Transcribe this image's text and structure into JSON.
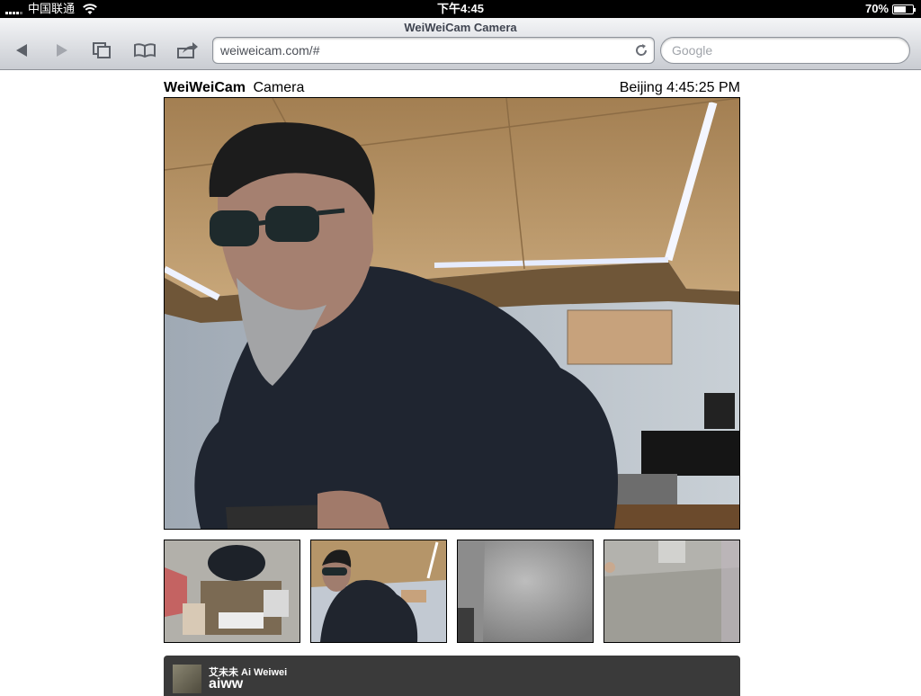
{
  "status_bar": {
    "carrier": "中国联通",
    "time": "下午4:45",
    "battery": "70%",
    "battery_level": 0.7
  },
  "browser": {
    "page_title": "WeiWeiCam Camera",
    "url": "weiweicam.com/#",
    "search_placeholder": "Google",
    "icons": {
      "back": "back-arrow-icon",
      "forward": "forward-arrow-icon",
      "pages": "pages-icon",
      "bookmarks": "bookmarks-icon",
      "share": "share-icon",
      "reload": "reload-icon"
    }
  },
  "page": {
    "brand": "WeiWeiCam",
    "subtitle": "Camera",
    "clock": "Beijing 4:45:25 PM"
  },
  "feed": {
    "name": "艾未未 Ai Weiwei",
    "handle": "aiww"
  },
  "colors": {
    "chrome_top": "#f4f5f7",
    "chrome_bottom": "#c9ccd2",
    "feed_bg": "#3a3a3a"
  }
}
